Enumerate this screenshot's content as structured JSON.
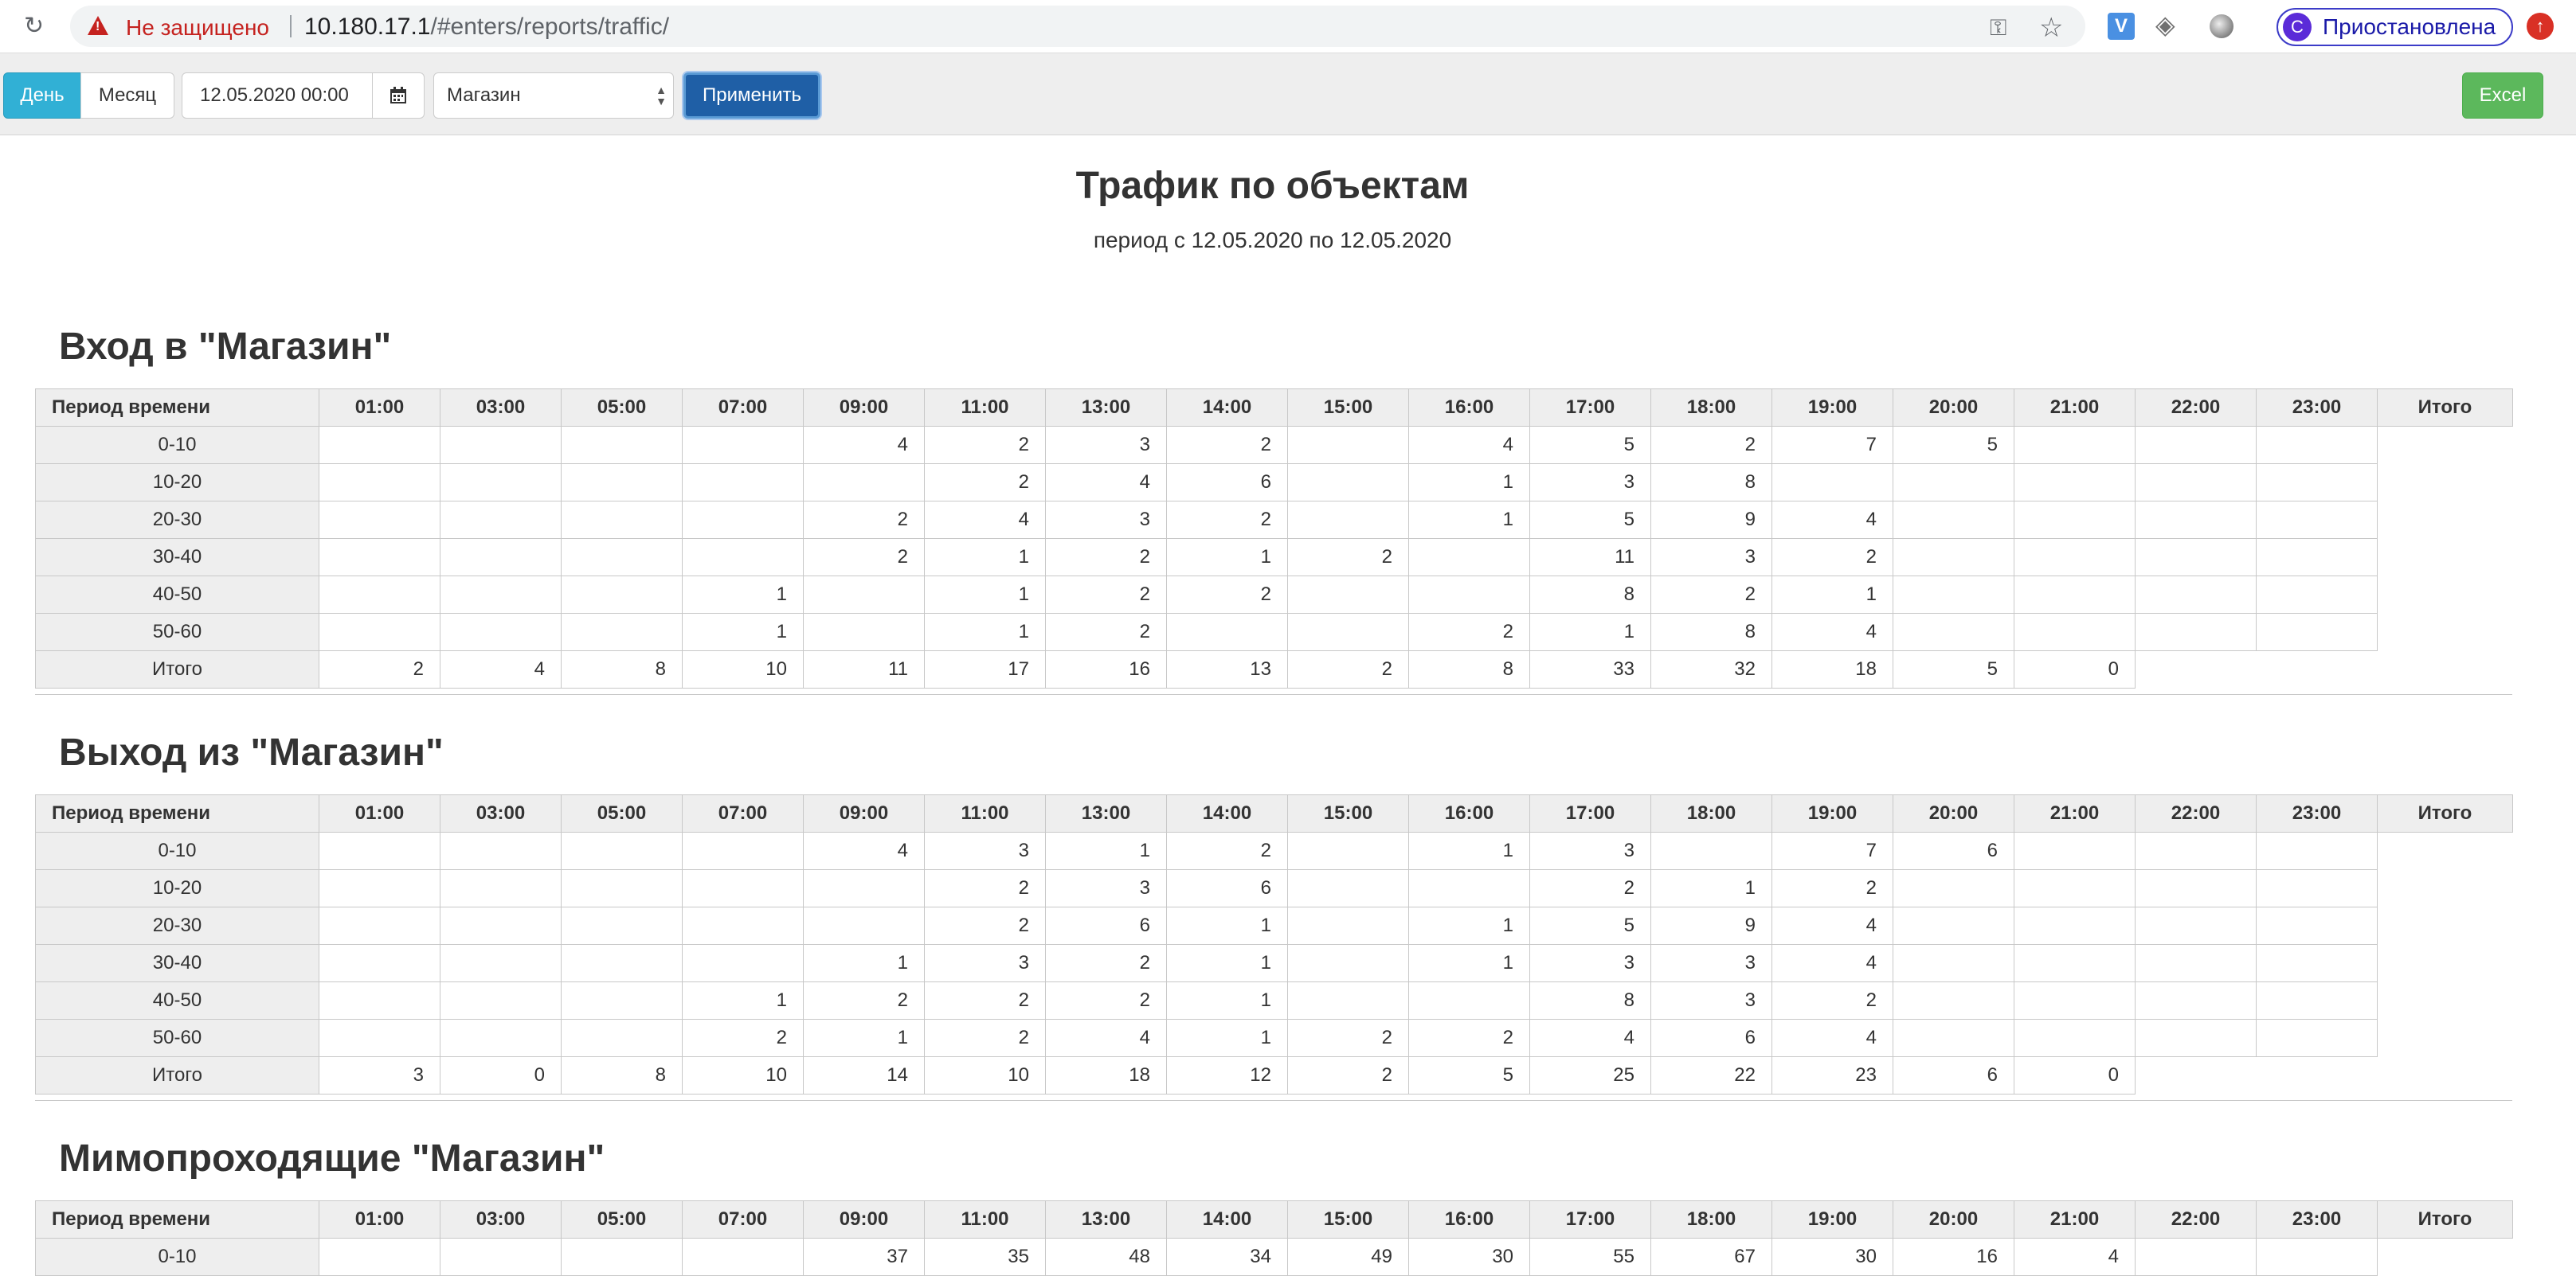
{
  "browser": {
    "security_text": "Не защищено",
    "url_host": "10.180.17.1",
    "url_path": "/#enters/reports/traffic/",
    "profile_initial": "С",
    "profile_status": "Приостановлена",
    "ext_v_label": "V",
    "icons": [
      "reload-icon",
      "warning-icon",
      "key-icon",
      "star-icon",
      "shield-icon",
      "circle-extension-icon",
      "update-icon"
    ]
  },
  "toolbar": {
    "day_label": "День",
    "month_label": "Месяц",
    "date_value": "12.05.2020 00:00",
    "select_value": "Магазин",
    "apply_label": "Применить",
    "excel_label": "Excel",
    "colors": {
      "day_active": "#31b0d5",
      "apply": "#1f5fa6",
      "excel": "#5cb85c"
    }
  },
  "report": {
    "title": "Трафик по объектам",
    "period": "период с 12.05.2020 по 12.05.2020"
  },
  "columns": [
    "Период времени",
    "01:00",
    "03:00",
    "05:00",
    "07:00",
    "09:00",
    "11:00",
    "13:00",
    "14:00",
    "15:00",
    "16:00",
    "17:00",
    "18:00",
    "19:00",
    "20:00",
    "21:00",
    "22:00",
    "23:00",
    "Итого"
  ],
  "sections": [
    {
      "title": "Вход в \"Магазин\"",
      "rows": [
        [
          "0-10",
          "",
          "",
          "",
          "",
          "4",
          "2",
          "3",
          "2",
          "",
          "4",
          "5",
          "2",
          "7",
          "5",
          "",
          "",
          ""
        ],
        [
          "10-20",
          "",
          "",
          "",
          "",
          "",
          "2",
          "4",
          "6",
          "",
          "1",
          "3",
          "8",
          "",
          "",
          "",
          "",
          ""
        ],
        [
          "20-30",
          "",
          "",
          "",
          "",
          "2",
          "4",
          "3",
          "2",
          "",
          "1",
          "5",
          "9",
          "4",
          "",
          "",
          "",
          ""
        ],
        [
          "30-40",
          "",
          "",
          "",
          "",
          "2",
          "1",
          "2",
          "1",
          "2",
          "",
          "11",
          "3",
          "2",
          "",
          "",
          "",
          ""
        ],
        [
          "40-50",
          "",
          "",
          "",
          "1",
          "",
          "1",
          "2",
          "2",
          "",
          "",
          "8",
          "2",
          "1",
          "",
          "",
          "",
          ""
        ],
        [
          "50-60",
          "",
          "",
          "",
          "1",
          "",
          "1",
          "2",
          "",
          "",
          "2",
          "1",
          "8",
          "4",
          "",
          "",
          "",
          ""
        ]
      ],
      "total": [
        "Итого",
        "2",
        "4",
        "8",
        "10",
        "11",
        "17",
        "16",
        "13",
        "2",
        "8",
        "33",
        "32",
        "18",
        "5",
        "0"
      ]
    },
    {
      "title": "Выход из \"Магазин\"",
      "rows": [
        [
          "0-10",
          "",
          "",
          "",
          "",
          "4",
          "3",
          "1",
          "2",
          "",
          "1",
          "3",
          "",
          "7",
          "6",
          "",
          "",
          ""
        ],
        [
          "10-20",
          "",
          "",
          "",
          "",
          "",
          "2",
          "3",
          "6",
          "",
          "",
          "2",
          "1",
          "2",
          "",
          "",
          "",
          ""
        ],
        [
          "20-30",
          "",
          "",
          "",
          "",
          "",
          "2",
          "6",
          "1",
          "",
          "1",
          "5",
          "9",
          "4",
          "",
          "",
          "",
          ""
        ],
        [
          "30-40",
          "",
          "",
          "",
          "",
          "1",
          "3",
          "2",
          "1",
          "",
          "1",
          "3",
          "3",
          "4",
          "",
          "",
          "",
          ""
        ],
        [
          "40-50",
          "",
          "",
          "",
          "1",
          "2",
          "2",
          "2",
          "1",
          "",
          "",
          "8",
          "3",
          "2",
          "",
          "",
          "",
          ""
        ],
        [
          "50-60",
          "",
          "",
          "",
          "2",
          "1",
          "2",
          "4",
          "1",
          "2",
          "2",
          "4",
          "6",
          "4",
          "",
          "",
          "",
          ""
        ]
      ],
      "total": [
        "Итого",
        "3",
        "0",
        "8",
        "10",
        "14",
        "10",
        "18",
        "12",
        "2",
        "5",
        "25",
        "22",
        "23",
        "6",
        "0"
      ]
    },
    {
      "title": "Мимопроходящие \"Магазин\"",
      "rows": [
        [
          "0-10",
          "",
          "",
          "",
          "",
          "37",
          "35",
          "48",
          "34",
          "49",
          "30",
          "55",
          "67",
          "30",
          "16",
          "4",
          "",
          ""
        ]
      ],
      "total": null
    }
  ]
}
